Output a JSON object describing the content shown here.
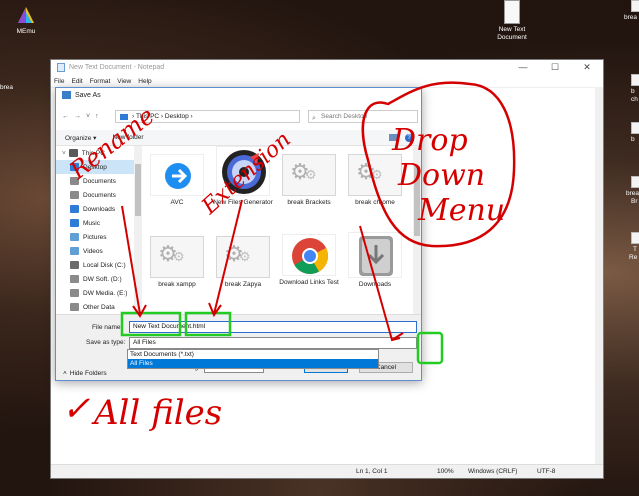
{
  "desktop": {
    "memu_label": "MEmu",
    "new_text_doc_label": "New Text Document",
    "side_labels": [
      "brea",
      "b",
      "ch",
      "b",
      "brea",
      "Br",
      "T",
      "Re"
    ]
  },
  "notepad": {
    "title": "New Text Document - Notepad",
    "menu": [
      "File",
      "Edit",
      "Format",
      "View",
      "Help"
    ],
    "status": {
      "position": "Ln 1, Col 1",
      "zoom": "100%",
      "line_endings": "Windows (CRLF)",
      "encoding": "UTF-8"
    }
  },
  "dialog": {
    "title": "Save As",
    "breadcrumb": [
      "This PC",
      "Desktop"
    ],
    "search_placeholder": "Search Desktop",
    "organize_label": "Organize ▾",
    "new_folder_label": "New folder",
    "nav_items": [
      {
        "label": "This PC",
        "icon": "computer-icon",
        "color": "#5a5a5a"
      },
      {
        "label": "Desktop",
        "icon": "desktop-icon",
        "color": "#2f7bd8"
      },
      {
        "label": "Documents",
        "icon": "document-icon",
        "color": "#8a8a8a"
      },
      {
        "label": "Documents",
        "icon": "documents-icon",
        "color": "#8a8a8a"
      },
      {
        "label": "Downloads",
        "icon": "download-icon",
        "color": "#2f7bd8"
      },
      {
        "label": "Music",
        "icon": "music-icon",
        "color": "#2f7bd8"
      },
      {
        "label": "Pictures",
        "icon": "pictures-icon",
        "color": "#5f9fd6"
      },
      {
        "label": "Videos",
        "icon": "videos-icon",
        "color": "#5f9fd6"
      },
      {
        "label": "Local Disk (C:)",
        "icon": "drive-icon",
        "color": "#6b6b6b"
      },
      {
        "label": "DW Soft. (D:)",
        "icon": "drive-icon",
        "color": "#8a8a8a"
      },
      {
        "label": "DW Media. (E:)",
        "icon": "drive-icon",
        "color": "#8a8a8a"
      },
      {
        "label": "Other Data",
        "icon": "drive-icon",
        "color": "#8a8a8a"
      }
    ],
    "files": [
      {
        "label": "AVC",
        "icon": "arrow-right-circle-icon"
      },
      {
        "label": "New Files Generator",
        "icon": "disc-icon"
      },
      {
        "label": "break Brackets",
        "icon": "gear-icon"
      },
      {
        "label": "break chrome",
        "icon": "gear-icon"
      },
      {
        "label": "break xampp",
        "icon": "gear-icon"
      },
      {
        "label": "break Zapya",
        "icon": "gear-icon"
      },
      {
        "label": "Download Links Test",
        "icon": "chrome-icon"
      },
      {
        "label": "Downloads",
        "icon": "download-folder-icon"
      }
    ],
    "file_name_label": "File name:",
    "file_name_value": "New Text Document.html",
    "save_as_type_label": "Save as type:",
    "save_as_type_value": "All Files",
    "type_options": [
      "Text Documents (*.txt)",
      "All Files"
    ],
    "encoding_label": "Encoding:",
    "encoding_value": "UTF-8",
    "save_label": "Save",
    "cancel_label": "Cancel",
    "hide_folders_label": "Hide Folders"
  },
  "annotations": {
    "rename": "Rename",
    "extension": "Extension",
    "drop_down_menu": [
      "Drop",
      "Down",
      "Menu"
    ],
    "all_files": "All files",
    "checkmark": "✓",
    "color": "#d40000",
    "highlight_color": "#22cc22"
  }
}
